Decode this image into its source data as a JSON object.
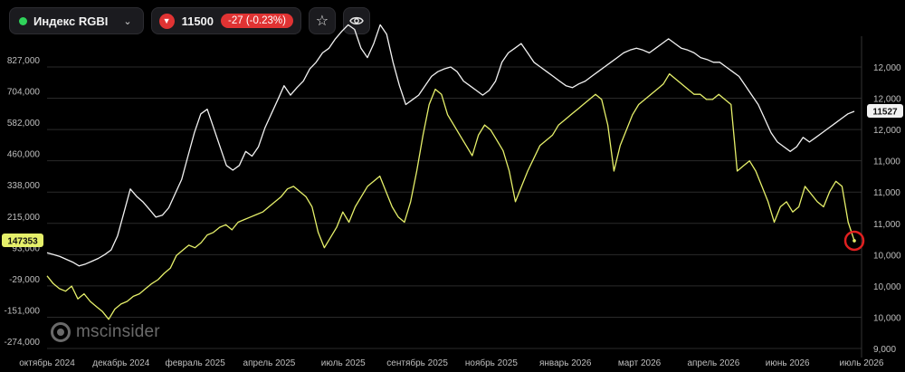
{
  "header": {
    "ticker_name": "Индекс RGBI",
    "chevron_icon": "chevron-down-icon",
    "status_dot_color": "#2fd35a",
    "price": "11500",
    "change": "-27 (-0.23%)",
    "down_icon": "triangle-down-icon",
    "star_icon": "star-icon",
    "eye_icon": "eye-icon"
  },
  "watermark": "mscinsider",
  "chart_data": {
    "type": "line",
    "x_labels": [
      "октябрь 2024",
      "декабрь 2024",
      "февраль 2025",
      "апрель 2025",
      "июль 2025",
      "сентябрь 2025",
      "ноябрь 2025",
      "январь 2026",
      "март 2026",
      "апрель 2026",
      "июнь 2026",
      "июль 2026"
    ],
    "left_axis": {
      "ticks": [
        "827,000",
        "704,000",
        "582,000",
        "460,000",
        "338,000",
        "215,000",
        "93,000",
        "-29,000",
        "-151,000",
        "-274,000"
      ],
      "range": [
        -274000,
        827000
      ]
    },
    "right_axis": {
      "ticks": [
        "12,000",
        "12,000",
        "12,000",
        "11,000",
        "11,000",
        "11,000",
        "10,000",
        "10,000",
        "10,000",
        "9,000"
      ],
      "range": [
        9000,
        12000
      ]
    },
    "series": [
      {
        "axis": "left",
        "color": "#e6f06a",
        "last_value_label": "147353",
        "values": [
          10000,
          -20000,
          -40000,
          -50000,
          -30000,
          -80000,
          -60000,
          -90000,
          -110000,
          -130000,
          -160000,
          -120000,
          -100000,
          -90000,
          -70000,
          -60000,
          -40000,
          -20000,
          -5000,
          20000,
          40000,
          90000,
          110000,
          130000,
          120000,
          140000,
          170000,
          180000,
          200000,
          210000,
          190000,
          220000,
          230000,
          240000,
          250000,
          260000,
          280000,
          300000,
          320000,
          350000,
          360000,
          340000,
          320000,
          280000,
          180000,
          120000,
          160000,
          200000,
          260000,
          220000,
          280000,
          320000,
          360000,
          380000,
          400000,
          340000,
          280000,
          240000,
          220000,
          300000,
          420000,
          560000,
          680000,
          740000,
          720000,
          640000,
          600000,
          560000,
          520000,
          480000,
          560000,
          600000,
          580000,
          540000,
          500000,
          420000,
          300000,
          360000,
          420000,
          470000,
          520000,
          540000,
          560000,
          600000,
          620000,
          640000,
          660000,
          680000,
          700000,
          720000,
          700000,
          600000,
          420000,
          520000,
          580000,
          640000,
          680000,
          700000,
          720000,
          740000,
          760000,
          800000,
          780000,
          760000,
          740000,
          720000,
          720000,
          700000,
          700000,
          720000,
          700000,
          680000,
          420000,
          440000,
          460000,
          420000,
          360000,
          300000,
          220000,
          280000,
          300000,
          260000,
          280000,
          360000,
          330000,
          300000,
          280000,
          340000,
          380000,
          360000,
          220000,
          147353
        ]
      },
      {
        "axis": "right",
        "color": "#f2f2f2",
        "last_value_label": "11527",
        "values": [
          10020,
          10000,
          9980,
          9950,
          9920,
          9880,
          9900,
          9930,
          9960,
          10000,
          10050,
          10200,
          10450,
          10700,
          10620,
          10560,
          10480,
          10400,
          10420,
          10500,
          10650,
          10800,
          11050,
          11300,
          11500,
          11550,
          11350,
          11150,
          10950,
          10900,
          10950,
          11100,
          11050,
          11150,
          11350,
          11500,
          11650,
          11800,
          11700,
          11780,
          11850,
          11980,
          12050,
          12150,
          12200,
          12300,
          12380,
          12450,
          12400,
          12200,
          12100,
          12250,
          12450,
          12350,
          12050,
          11800,
          11600,
          11650,
          11700,
          11800,
          11900,
          11950,
          11980,
          12000,
          11950,
          11850,
          11800,
          11750,
          11700,
          11750,
          11850,
          12050,
          12150,
          12200,
          12250,
          12150,
          12050,
          12000,
          11950,
          11900,
          11850,
          11800,
          11780,
          11820,
          11850,
          11900,
          11950,
          12000,
          12050,
          12100,
          12150,
          12180,
          12200,
          12180,
          12150,
          12200,
          12250,
          12300,
          12250,
          12200,
          12180,
          12150,
          12100,
          12080,
          12050,
          12050,
          12000,
          11950,
          11900,
          11800,
          11700,
          11600,
          11450,
          11300,
          11200,
          11150,
          11100,
          11150,
          11250,
          11200,
          11250,
          11300,
          11350,
          11400,
          11450,
          11500,
          11527
        ]
      }
    ],
    "last_point_marker": "circle",
    "grid": true
  }
}
